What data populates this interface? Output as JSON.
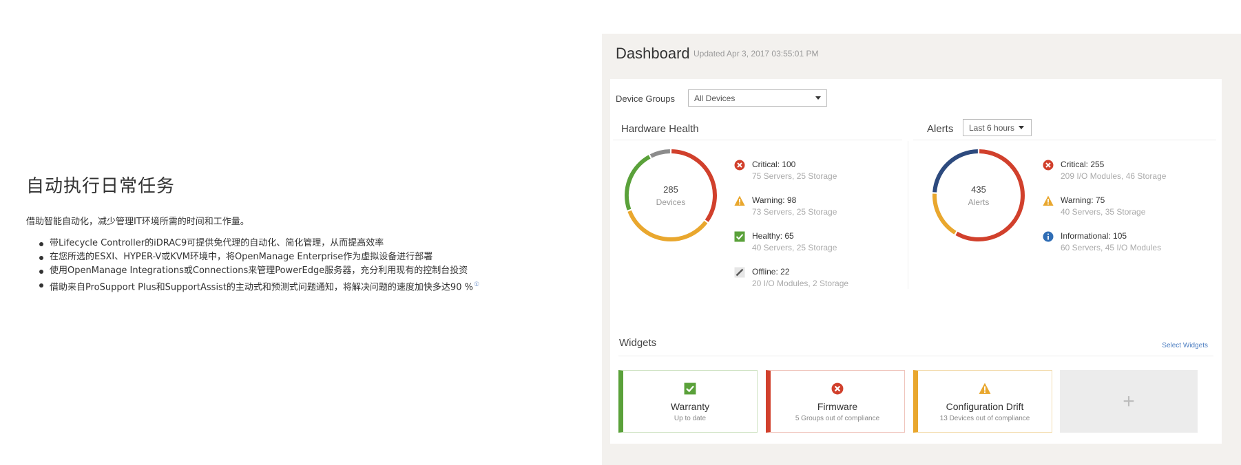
{
  "left": {
    "heading": "自动执行日常任务",
    "lead": "借助智能自动化，减少管理IT环境所需的时间和工作量。",
    "bullets": [
      "带Lifecycle Controller的iDRAC9可提供免代理的自动化、简化管理，从而提高效率",
      "在您所选的ESXI、HYPER-V或KVM环境中，将OpenManage Enterprise作为虚拟设备进行部署",
      "使用OpenManage Integrations或Connections来管理PowerEdge服务器，充分利用现有的控制台投资",
      "借助来自ProSupport Plus和SupportAssist的主动式和预测式问题通知，将解决问题的速度加快多达90 %"
    ],
    "footnote_mark": "①"
  },
  "dashboard": {
    "title": "Dashboard",
    "updated": "Updated Apr 3, 2017 03:55:01 PM",
    "device_groups_label": "Device Groups",
    "device_groups_value": "All Devices",
    "hardware": {
      "heading": "Hardware Health",
      "center_value": "285",
      "center_label": "Devices",
      "items": [
        {
          "icon": "critical-icon",
          "title": "Critical: 100",
          "sub": "75 Servers, 25 Storage",
          "color": "#d1402c",
          "value": 100
        },
        {
          "icon": "warning-icon",
          "title": "Warning: 98",
          "sub": "73 Servers, 25 Storage",
          "color": "#e9a72e",
          "value": 98
        },
        {
          "icon": "healthy-icon",
          "title": "Healthy: 65",
          "sub": "40 Servers, 25 Storage",
          "color": "#5aa13a",
          "value": 65
        },
        {
          "icon": "offline-icon",
          "title": "Offline: 22",
          "sub": "20 I/O Modules, 2 Storage",
          "color": "#8c8c8c",
          "value": 22
        }
      ]
    },
    "alerts": {
      "heading": "Alerts",
      "range_value": "Last 6 hours",
      "center_value": "435",
      "center_label": "Alerts",
      "items": [
        {
          "icon": "critical-icon",
          "title": "Critical: 255",
          "sub": "209 I/O Modules, 46 Storage",
          "color": "#d1402c",
          "value": 255
        },
        {
          "icon": "warning-icon",
          "title": "Warning: 75",
          "sub": "40 Servers, 35 Storage",
          "color": "#e9a72e",
          "value": 75
        },
        {
          "icon": "info-icon",
          "title": "Informational: 105",
          "sub": "60 Servers, 45 I/O Modules",
          "color": "#2d4a7e",
          "value": 105
        }
      ]
    },
    "widgets": {
      "heading": "Widgets",
      "select_label": "Select Widgets",
      "items": [
        {
          "icon": "check-icon",
          "title": "Warranty",
          "sub": "Up to date",
          "color": "#5aa13a"
        },
        {
          "icon": "error-icon",
          "title": "Firmware",
          "sub": "5 Groups out of compliance",
          "color": "#d1402c"
        },
        {
          "icon": "warning-icon",
          "title": "Configuration Drift",
          "sub": "13 Devices out of compliance",
          "color": "#e9a72e"
        }
      ],
      "add_label": "+"
    }
  }
}
